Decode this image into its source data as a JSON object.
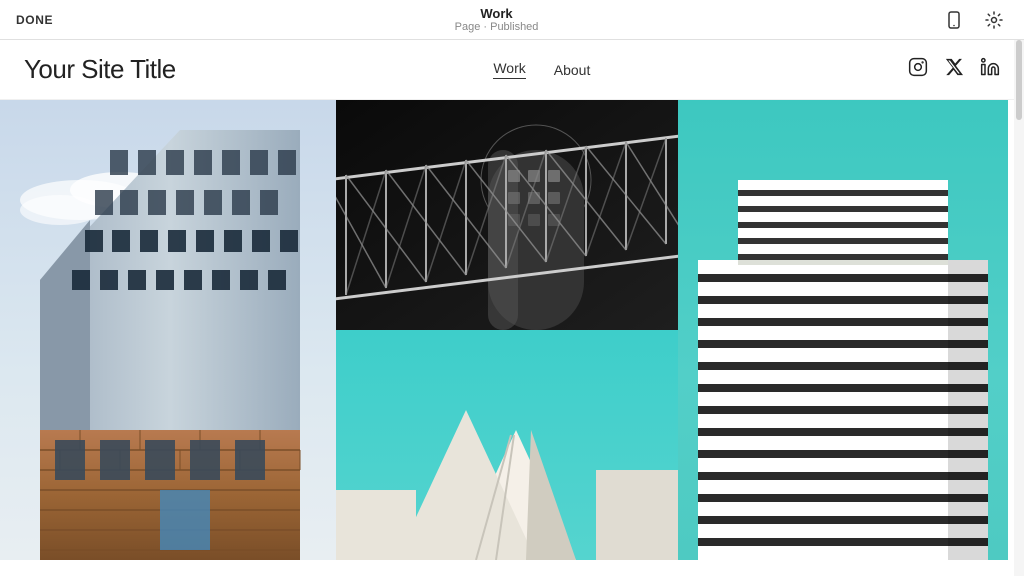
{
  "topbar": {
    "done_label": "DONE",
    "page_title": "Work",
    "page_subtitle": "Page · Published"
  },
  "header": {
    "site_title": "Your Site Title",
    "nav": [
      {
        "label": "Work",
        "active": true
      },
      {
        "label": "About",
        "active": false
      }
    ],
    "social": [
      {
        "name": "instagram",
        "symbol": "⬜"
      },
      {
        "name": "twitter",
        "symbol": "✕"
      },
      {
        "name": "linkedin",
        "symbol": "in"
      }
    ]
  },
  "grid": {
    "cells": [
      {
        "id": 1,
        "alt": "Tall angular skyscraper with copper base"
      },
      {
        "id": 2,
        "alt": "Bridge railing with building behind"
      },
      {
        "id": 3,
        "alt": "Striped modern building teal sky top"
      },
      {
        "id": 4,
        "alt": "Teal sky with building roofline"
      },
      {
        "id": 5,
        "alt": "White modern building teal sky bottom"
      }
    ]
  }
}
